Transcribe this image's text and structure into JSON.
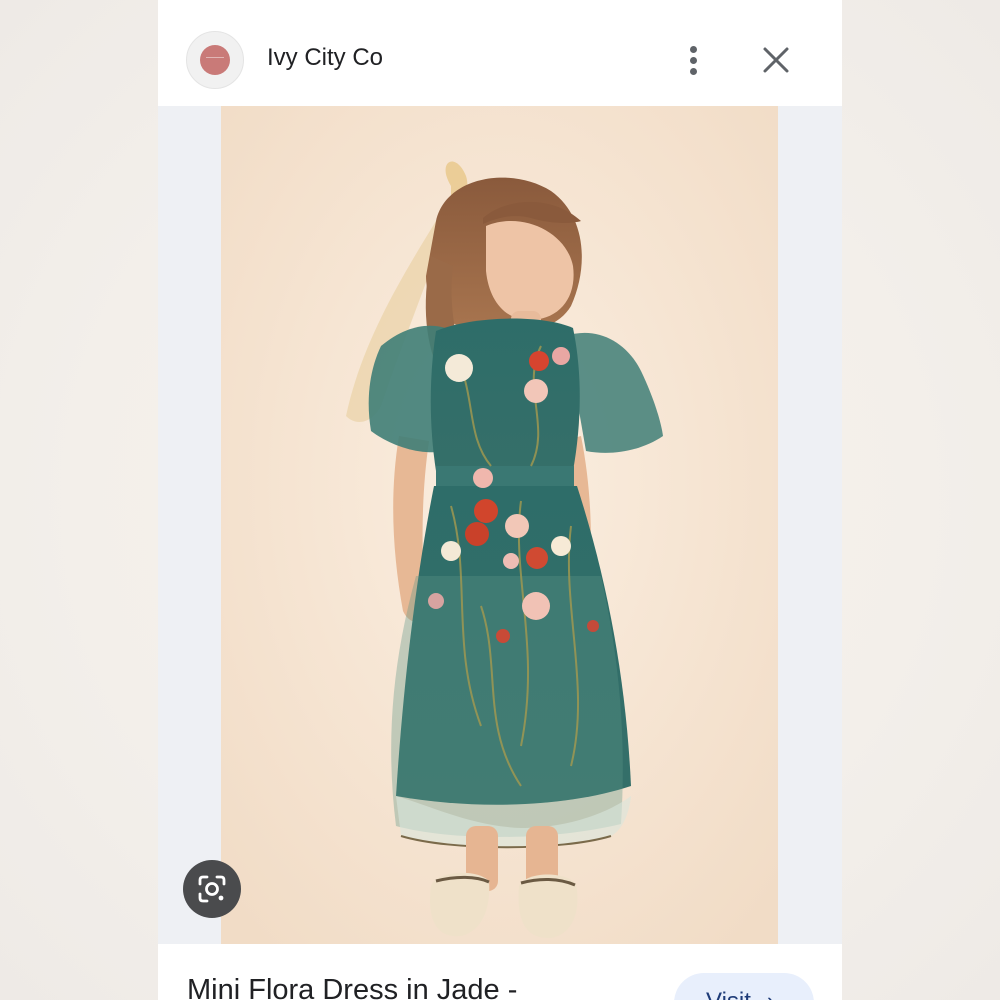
{
  "header": {
    "site_name": "Ivy City Co",
    "more_icon": "more-vert-icon",
    "close_icon": "close-icon"
  },
  "image": {
    "lens_icon": "google-lens-icon"
  },
  "footer": {
    "product_title": "Mini Flora Dress in Jade -",
    "visit_label": "Visit",
    "visit_icon": "chevron-right-icon"
  },
  "colors": {
    "accent_button_bg": "#e8effc",
    "accent_button_text": "#1f3c78",
    "dress": "#2f6f6a"
  }
}
